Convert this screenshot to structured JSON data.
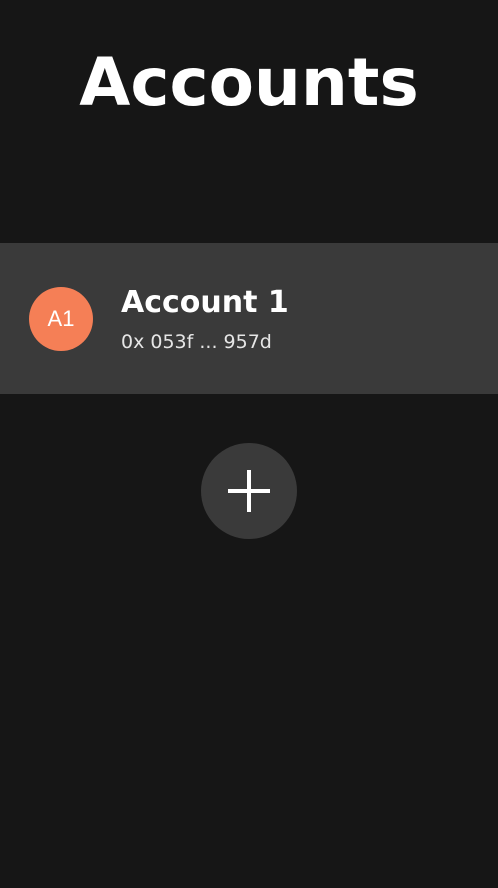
{
  "header": {
    "title": "Accounts"
  },
  "accounts": [
    {
      "avatar_initials": "A1",
      "name": "Account 1",
      "address": "0x 053f ... 957d"
    }
  ],
  "actions": {
    "add_icon": "plus-icon"
  },
  "colors": {
    "background": "#161616",
    "row_background": "#3a3a3a",
    "avatar_accent": "#f57f56",
    "text": "#ffffff"
  }
}
